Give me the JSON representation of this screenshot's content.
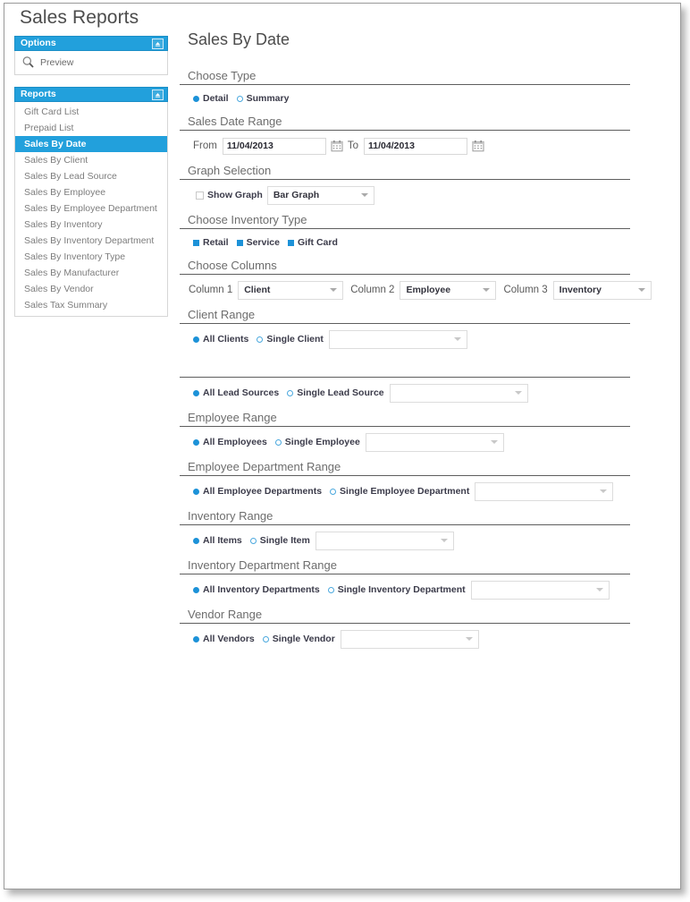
{
  "window": {
    "page_title": "Sales Reports"
  },
  "sidebar": {
    "options_panel": {
      "title": "Options",
      "collapse_icon": "collapse-up-icon",
      "items": [
        {
          "label": "Preview",
          "icon": "magnifier-icon"
        }
      ]
    },
    "reports_panel": {
      "title": "Reports",
      "collapse_icon": "collapse-up-icon",
      "items": [
        {
          "label": "Gift Card List",
          "selected": false
        },
        {
          "label": "Prepaid List",
          "selected": false
        },
        {
          "label": "Sales By Date",
          "selected": true
        },
        {
          "label": "Sales By Client",
          "selected": false
        },
        {
          "label": "Sales By Lead Source",
          "selected": false
        },
        {
          "label": "Sales By Employee",
          "selected": false
        },
        {
          "label": "Sales By Employee Department",
          "selected": false
        },
        {
          "label": "Sales By Inventory",
          "selected": false
        },
        {
          "label": "Sales By Inventory Department",
          "selected": false
        },
        {
          "label": "Sales By Inventory Type",
          "selected": false
        },
        {
          "label": "Sales By Manufacturer",
          "selected": false
        },
        {
          "label": "Sales By Vendor",
          "selected": false
        },
        {
          "label": "Sales Tax Summary",
          "selected": false
        }
      ]
    }
  },
  "main": {
    "title": "Sales By Date",
    "choose_type": {
      "heading": "Choose Type",
      "options": [
        {
          "label": "Detail",
          "selected": true
        },
        {
          "label": "Summary",
          "selected": false
        }
      ]
    },
    "sales_date_range": {
      "heading": "Sales Date Range",
      "from_label": "From",
      "from_value": "11/04/2013",
      "to_label": "To",
      "to_value": "11/04/2013",
      "calendar_icon": "calendar-icon"
    },
    "graph_selection": {
      "heading": "Graph Selection",
      "show_graph_label": "Show Graph",
      "show_graph_checked": false,
      "graph_type_value": "Bar Graph"
    },
    "inventory_type": {
      "heading": "Choose Inventory Type",
      "options": [
        {
          "label": "Retail",
          "checked": true
        },
        {
          "label": "Service",
          "checked": true
        },
        {
          "label": "Gift Card",
          "checked": true
        }
      ]
    },
    "choose_columns": {
      "heading": "Choose Columns",
      "columns": [
        {
          "label": "Column 1",
          "value": "Client"
        },
        {
          "label": "Column 2",
          "value": "Employee"
        },
        {
          "label": "Column 3",
          "value": "Inventory"
        }
      ]
    },
    "client_range": {
      "heading": "Client Range",
      "all_label": "All Clients",
      "all_selected": true,
      "single_label": "Single Client",
      "single_selected": false,
      "select_value": ""
    },
    "lead_source_range": {
      "heading": "",
      "all_label": "All Lead Sources",
      "all_selected": true,
      "single_label": "Single Lead Source",
      "single_selected": false,
      "select_value": ""
    },
    "employee_range": {
      "heading": "Employee Range",
      "all_label": "All Employees",
      "all_selected": true,
      "single_label": "Single Employee",
      "single_selected": false,
      "select_value": ""
    },
    "employee_department_range": {
      "heading": "Employee Department Range",
      "all_label": "All Employee Departments",
      "all_selected": true,
      "single_label": "Single Employee Department",
      "single_selected": false,
      "select_value": ""
    },
    "inventory_range": {
      "heading": "Inventory Range",
      "all_label": "All Items",
      "all_selected": true,
      "single_label": "Single Item",
      "single_selected": false,
      "select_value": ""
    },
    "inventory_department_range": {
      "heading": "Inventory Department Range",
      "all_label": "All Inventory Departments",
      "all_selected": true,
      "single_label": "Single Inventory Department",
      "single_selected": false,
      "select_value": ""
    },
    "vendor_range": {
      "heading": "Vendor Range",
      "all_label": "All Vendors",
      "all_selected": true,
      "single_label": "Single Vendor",
      "single_selected": false,
      "select_value": ""
    }
  },
  "colors": {
    "accent_blue": "#22a0dc",
    "radio_blue": "#1d92d8",
    "heading_gray": "#6d6d6d",
    "rule_gray": "#5e5e5e"
  }
}
